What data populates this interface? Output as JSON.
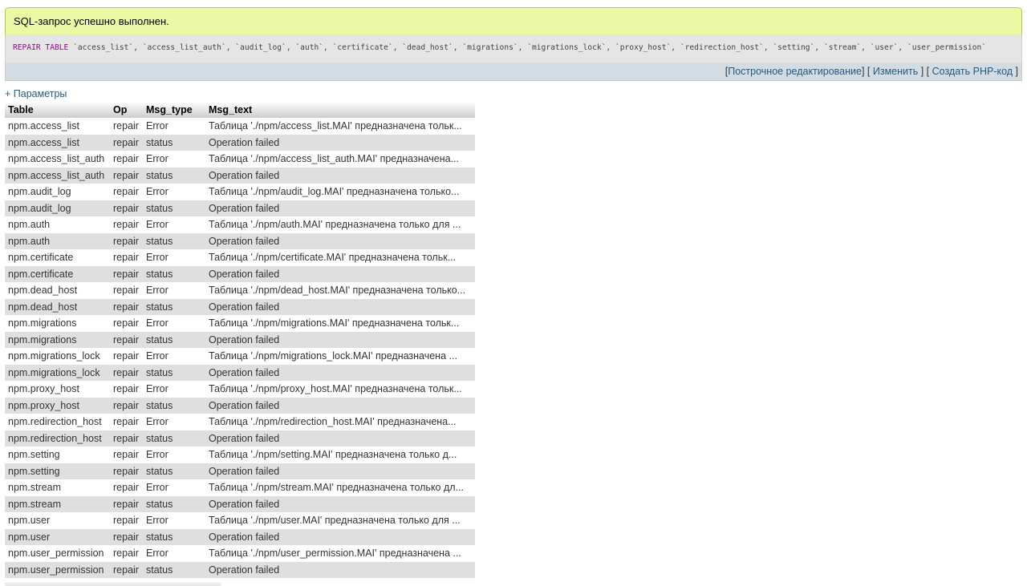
{
  "success": {
    "message": "SQL-запрос успешно выполнен."
  },
  "sql": {
    "keyword": "REPAIR TABLE",
    "tables": [
      "access_list",
      "access_list_auth",
      "audit_log",
      "auth",
      "certificate",
      "dead_host",
      "migrations",
      "migrations_lock",
      "proxy_host",
      "redirection_host",
      "setting",
      "stream",
      "user",
      "user_permission"
    ]
  },
  "tools": {
    "inline_edit": "Построчное редактирование",
    "edit": "Изменить",
    "create_php": "Создать PHP-код"
  },
  "params": {
    "label": "+ Параметры"
  },
  "table": {
    "columns": [
      "Table",
      "Op",
      "Msg_type",
      "Msg_text"
    ],
    "rows": [
      [
        "npm.access_list",
        "repair",
        "Error",
        "Таблица './npm/access_list.MAI' предназначена тольк..."
      ],
      [
        "npm.access_list",
        "repair",
        "status",
        "Operation failed"
      ],
      [
        "npm.access_list_auth",
        "repair",
        "Error",
        "Таблица './npm/access_list_auth.MAI' предназначена..."
      ],
      [
        "npm.access_list_auth",
        "repair",
        "status",
        "Operation failed"
      ],
      [
        "npm.audit_log",
        "repair",
        "Error",
        "Таблица './npm/audit_log.MAI' предназначена только..."
      ],
      [
        "npm.audit_log",
        "repair",
        "status",
        "Operation failed"
      ],
      [
        "npm.auth",
        "repair",
        "Error",
        "Таблица './npm/auth.MAI' предназначена только для ..."
      ],
      [
        "npm.auth",
        "repair",
        "status",
        "Operation failed"
      ],
      [
        "npm.certificate",
        "repair",
        "Error",
        "Таблица './npm/certificate.MAI' предназначена тольк..."
      ],
      [
        "npm.certificate",
        "repair",
        "status",
        "Operation failed"
      ],
      [
        "npm.dead_host",
        "repair",
        "Error",
        "Таблица './npm/dead_host.MAI' предназначена только..."
      ],
      [
        "npm.dead_host",
        "repair",
        "status",
        "Operation failed"
      ],
      [
        "npm.migrations",
        "repair",
        "Error",
        "Таблица './npm/migrations.MAI' предназначена тольк..."
      ],
      [
        "npm.migrations",
        "repair",
        "status",
        "Operation failed"
      ],
      [
        "npm.migrations_lock",
        "repair",
        "Error",
        "Таблица './npm/migrations_lock.MAI' предназначена ..."
      ],
      [
        "npm.migrations_lock",
        "repair",
        "status",
        "Operation failed"
      ],
      [
        "npm.proxy_host",
        "repair",
        "Error",
        "Таблица './npm/proxy_host.MAI' предназначена тольк..."
      ],
      [
        "npm.proxy_host",
        "repair",
        "status",
        "Operation failed"
      ],
      [
        "npm.redirection_host",
        "repair",
        "Error",
        "Таблица './npm/redirection_host.MAI' предназначена..."
      ],
      [
        "npm.redirection_host",
        "repair",
        "status",
        "Operation failed"
      ],
      [
        "npm.setting",
        "repair",
        "Error",
        "Таблица './npm/setting.MAI' предназначена только д..."
      ],
      [
        "npm.setting",
        "repair",
        "status",
        "Operation failed"
      ],
      [
        "npm.stream",
        "repair",
        "Error",
        "Таблица './npm/stream.MAI' предназначена только дл..."
      ],
      [
        "npm.stream",
        "repair",
        "status",
        "Operation failed"
      ],
      [
        "npm.user",
        "repair",
        "Error",
        "Таблица './npm/user.MAI' предназначена только для ..."
      ],
      [
        "npm.user",
        "repair",
        "status",
        "Operation failed"
      ],
      [
        "npm.user_permission",
        "repair",
        "Error",
        "Таблица './npm/user_permission.MAI' предназначена ..."
      ],
      [
        "npm.user_permission",
        "repair",
        "status",
        "Operation failed"
      ]
    ]
  },
  "colors": {
    "success_bg": "#ebf8a4",
    "success_border": "#a2d246",
    "link": "#235a81",
    "keyword": "#990099",
    "row_even": "#dfdfdf"
  }
}
